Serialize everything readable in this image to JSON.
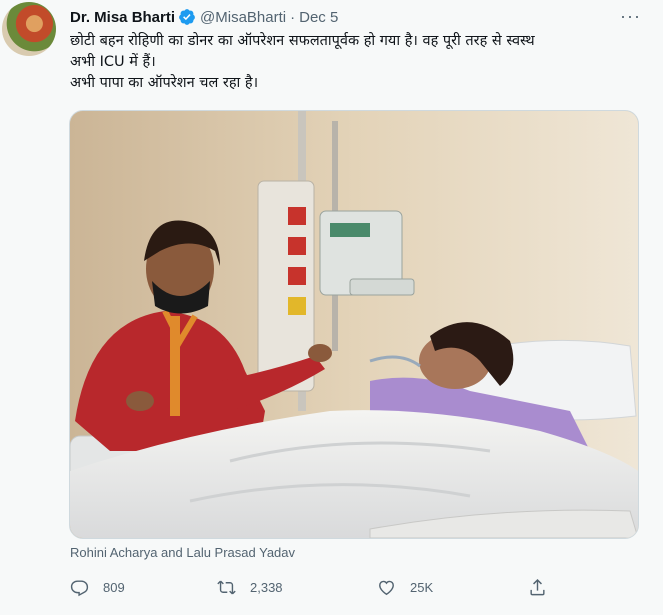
{
  "tweet": {
    "author_name": "Dr. Misa Bharti",
    "handle": "@MisaBharti",
    "separator": "·",
    "date": "Dec 5",
    "more_label": "···",
    "text_lines": [
      "छोटी बहन रोहिणी का डोनर का ऑपरेशन सफलतापूर्वक हो गया है। वह पूरी तरह से स्वस्थ",
      "अभी ICU में हैं।",
      "अभी पापा का ऑपरेशन चल रहा है।"
    ],
    "media_caption": "Rohini Acharya and Lalu Prasad Yadav",
    "counts": {
      "replies": "809",
      "retweets": "2,338",
      "likes": "25K"
    }
  },
  "colors": {
    "verified": "#1d9bf0",
    "secondary_text": "#536471",
    "background": "#f7f9f9"
  },
  "icons": [
    "verified-badge-icon",
    "more-icon",
    "reply-icon",
    "retweet-icon",
    "like-icon",
    "share-icon"
  ]
}
